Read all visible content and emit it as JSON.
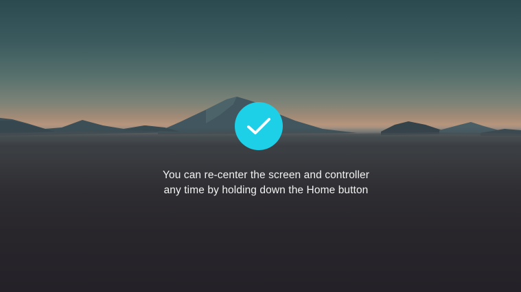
{
  "dialog": {
    "status_icon": "checkmark-icon",
    "message_lines": [
      "You can re-center the screen and controller",
      "any time by holding down the Home button"
    ]
  },
  "colors": {
    "accent": "#1ecfe8",
    "text": "#f2f2f2",
    "sky_top": "#2a4a50",
    "horizon_glow": "#b7957c",
    "ground": "#242228"
  }
}
